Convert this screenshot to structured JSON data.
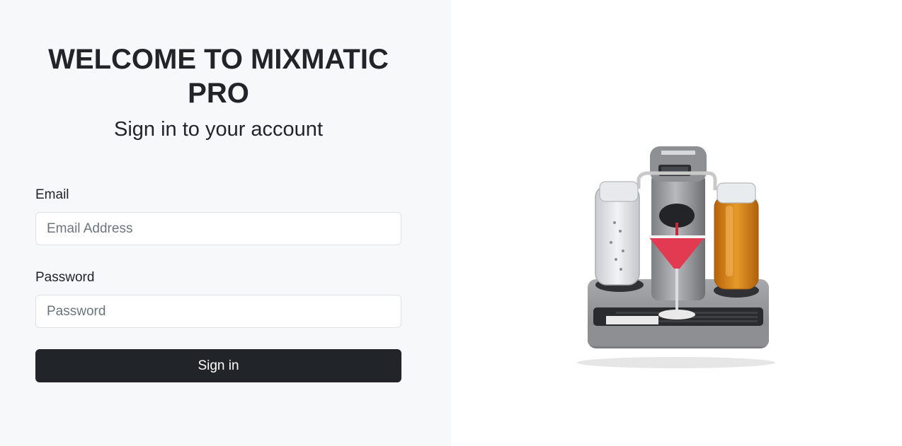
{
  "login": {
    "title": "WELCOME TO MIXMATIC PRO",
    "subtitle": "Sign in to your account",
    "email_label": "Email",
    "email_placeholder": "Email Address",
    "password_label": "Password",
    "password_placeholder": "Password",
    "submit_label": "Sign in"
  },
  "colors": {
    "panel_bg": "#f7f8fa",
    "button_bg": "#212529",
    "text": "#212529",
    "border": "#dee2e6"
  },
  "hero_image": {
    "icon": "cocktail-machine-product-photo"
  }
}
